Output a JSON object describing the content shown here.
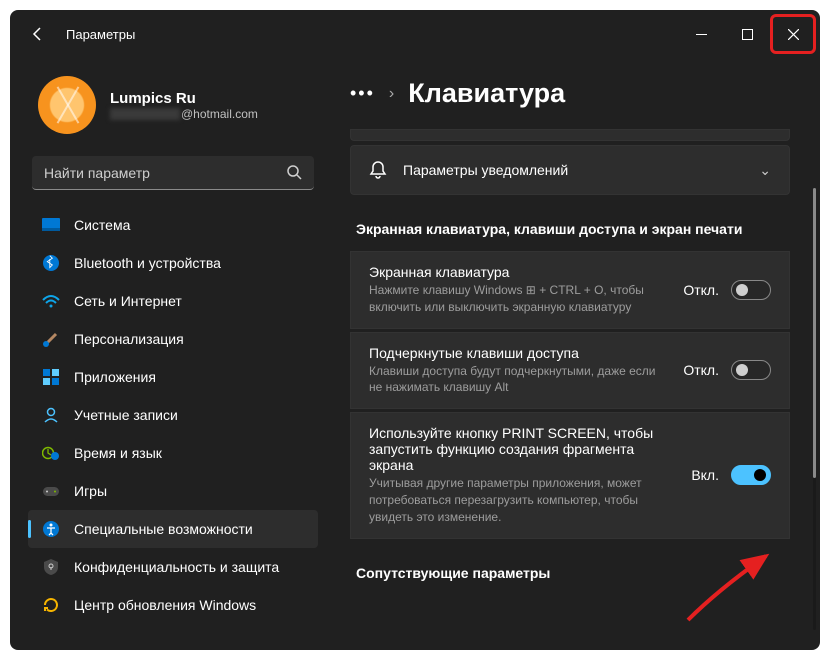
{
  "title": "Параметры",
  "user": {
    "name": "Lumpics Ru",
    "email_suffix": "@hotmail.com"
  },
  "search": {
    "placeholder": "Найти параметр"
  },
  "nav": {
    "items": [
      {
        "label": "Система"
      },
      {
        "label": "Bluetooth и устройства"
      },
      {
        "label": "Сеть и Интернет"
      },
      {
        "label": "Персонализация"
      },
      {
        "label": "Приложения"
      },
      {
        "label": "Учетные записи"
      },
      {
        "label": "Время и язык"
      },
      {
        "label": "Игры"
      },
      {
        "label": "Специальные возможности"
      },
      {
        "label": "Конфиденциальность и защита"
      },
      {
        "label": "Центр обновления Windows"
      }
    ]
  },
  "page": {
    "heading": "Клавиатура",
    "notif_card": "Параметры уведомлений",
    "section1": "Экранная клавиатура, клавиши доступа и экран печати",
    "settings": [
      {
        "title": "Экранная клавиатура",
        "desc": "Нажмите клавишу Windows ⊞ + CTRL + O, чтобы включить или выключить экранную клавиатуру",
        "state": "Откл."
      },
      {
        "title": "Подчеркнутые клавиши доступа",
        "desc": "Клавиши доступа будут подчеркнутыми, даже если не нажимать клавишу Alt",
        "state": "Откл."
      },
      {
        "title": "Используйте кнопку PRINT SCREEN, чтобы запустить функцию создания фрагмента экрана",
        "desc": "Учитывая другие параметры приложения, может потребоваться перезагрузить компьютер, чтобы увидеть это изменение.",
        "state": "Вкл."
      }
    ],
    "section2": "Сопутствующие параметры"
  }
}
